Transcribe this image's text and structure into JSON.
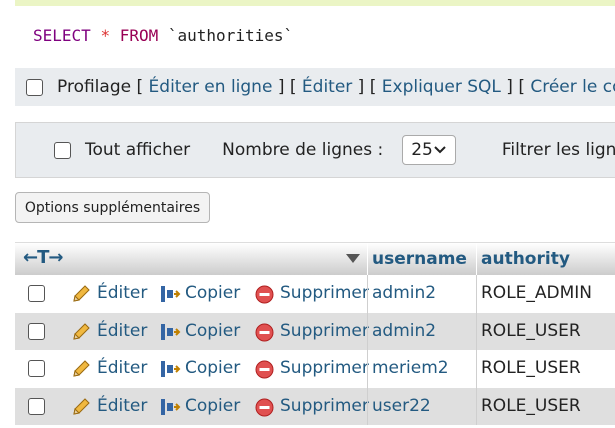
{
  "sql": {
    "keyword_select": "SELECT",
    "star": "*",
    "keyword_from": "FROM",
    "table": "`authorities`"
  },
  "profiling": {
    "label": "Profilage",
    "links": [
      "Éditer en ligne",
      "Éditer",
      "Expliquer SQL",
      "Créer le code sc"
    ]
  },
  "nav": {
    "show_all": "Tout afficher",
    "rows_label": "Nombre de lignes :",
    "rows_value": "25",
    "filter_label": "Filtrer les lignes"
  },
  "options_button": "Options supplémentaires",
  "table": {
    "columns": [
      "username",
      "authority"
    ],
    "actions": {
      "edit": "Éditer",
      "copy": "Copier",
      "delete": "Supprimer"
    },
    "rows": [
      {
        "username": "admin2",
        "authority": "ROLE_ADMIN"
      },
      {
        "username": "admin2",
        "authority": "ROLE_USER"
      },
      {
        "username": "meriem2",
        "authority": "ROLE_USER"
      },
      {
        "username": "user22",
        "authority": "ROLE_USER"
      }
    ]
  },
  "colors": {
    "link": "#235a81",
    "row_alt": "#dfdfdf",
    "panel": "#e9ecef"
  }
}
